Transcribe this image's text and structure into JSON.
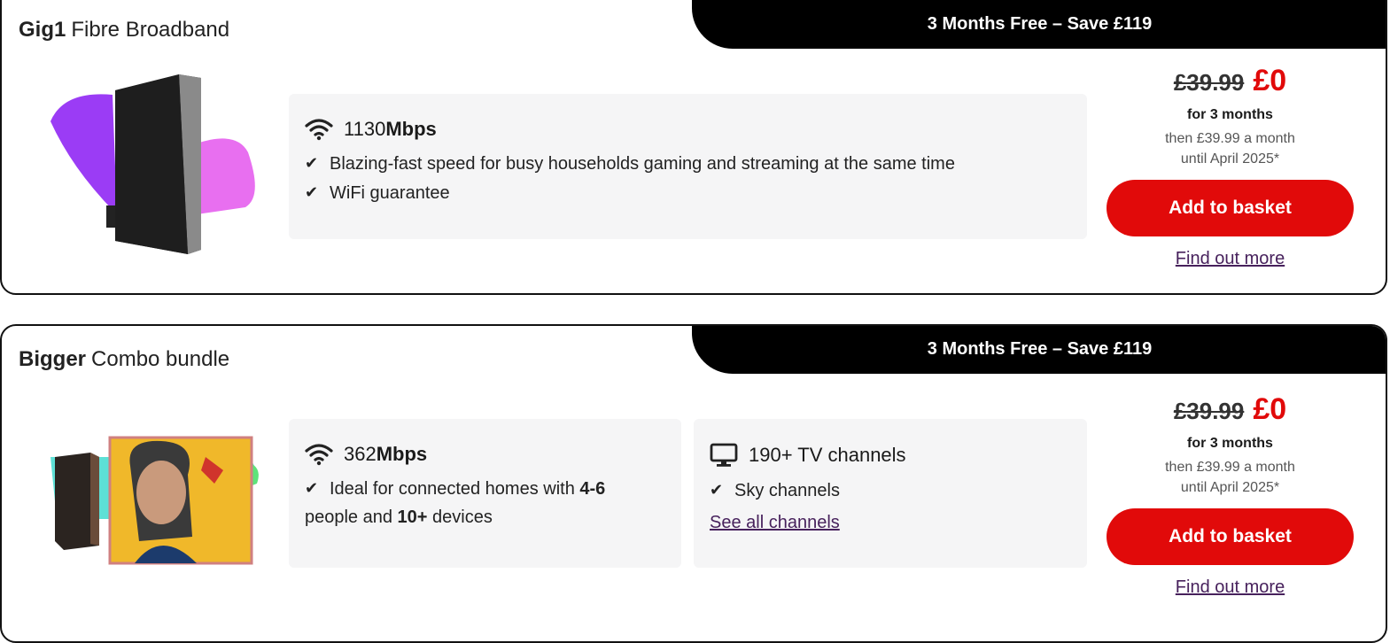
{
  "products": [
    {
      "promo": "3 Months Free – Save £119",
      "title_bold": "Gig1",
      "title_rest": "Fibre Broadband",
      "speed_number": "1130",
      "speed_unit": "Mbps",
      "features": [
        "Blazing-fast speed for busy households gaming and streaming at the same time",
        "WiFi guarantee"
      ],
      "old_price": "£39.99",
      "new_price": "£0",
      "for_months": "for 3 months",
      "then_line1": "then £39.99 a month",
      "then_line2": "until April 2025*",
      "basket_label": "Add to basket",
      "find_more": "Find out more"
    },
    {
      "promo": "3 Months Free – Save £119",
      "title_bold": "Bigger",
      "title_rest": "Combo bundle",
      "speed_number": "362",
      "speed_unit": "Mbps",
      "feature_pre": "Ideal for connected homes with ",
      "feature_b1": "4-6",
      "feature_mid": " people and ",
      "feature_b2": "10+",
      "feature_post": " devices",
      "tv_title": "190+ TV channels",
      "tv_feature": "Sky channels",
      "tv_link": "See all channels",
      "old_price": "£39.99",
      "new_price": "£0",
      "for_months": "for 3 months",
      "then_line1": "then £39.99 a month",
      "then_line2": "until April 2025*",
      "basket_label": "Add to basket",
      "find_more": "Find out more"
    }
  ],
  "colors": {
    "accent_red": "#e10a0a",
    "link_purple": "#47215c",
    "panel_grey": "#f5f5f6"
  }
}
